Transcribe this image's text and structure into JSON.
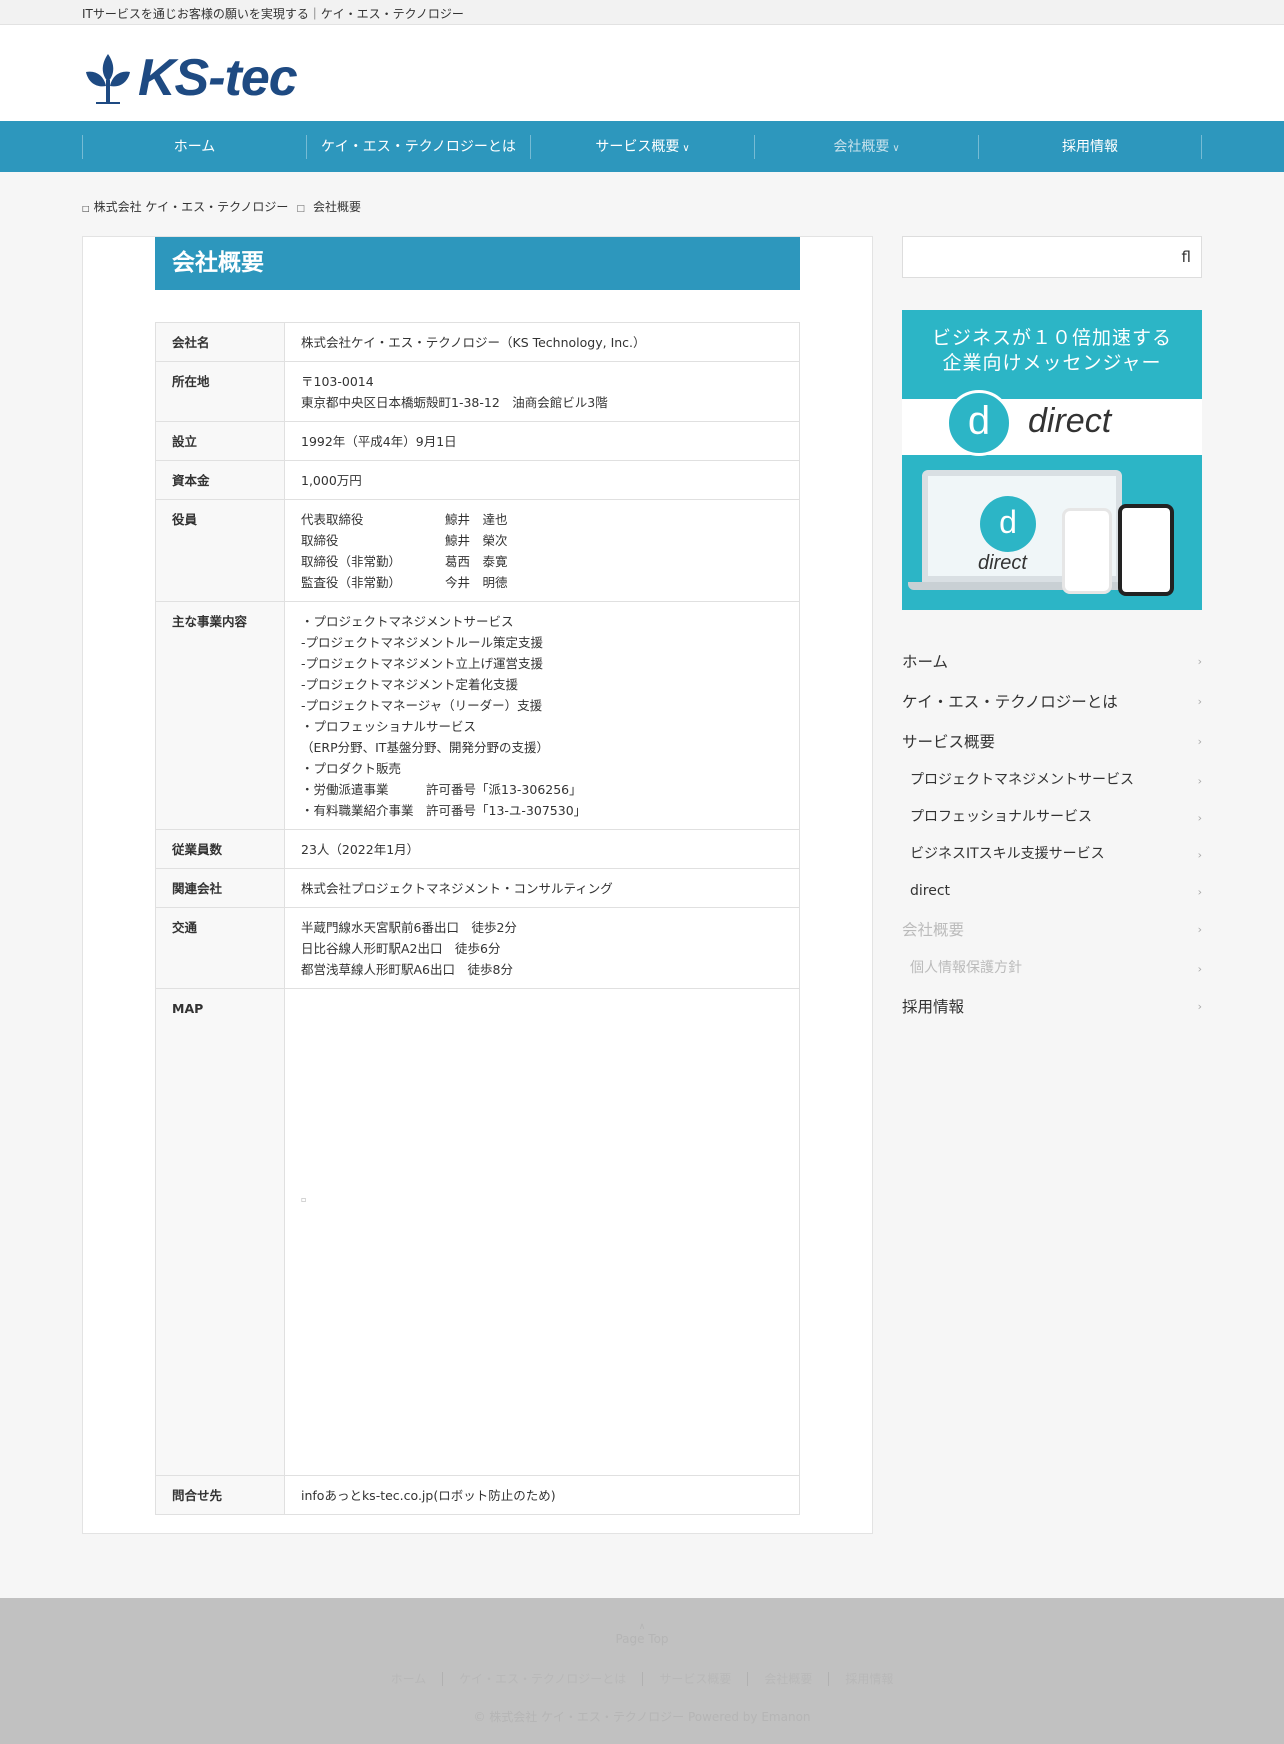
{
  "topbar": {
    "tagline": "ITサービスを通じお客様の願いを実現する｜ケイ・エス・テクノロジー"
  },
  "header": {
    "logo_text": "KS-tec"
  },
  "nav": {
    "items": [
      {
        "label": "ホーム",
        "has_dropdown": false,
        "active": false
      },
      {
        "label": "ケイ・エス・テクノロジーとは",
        "has_dropdown": false,
        "active": false
      },
      {
        "label": "サービス概要",
        "has_dropdown": true,
        "active": false
      },
      {
        "label": "会社概要",
        "has_dropdown": true,
        "active": true
      },
      {
        "label": "採用情報",
        "has_dropdown": false,
        "active": false
      }
    ]
  },
  "breadcrumb": {
    "home": "株式会社 ケイ・エス・テクノロジー",
    "current": "会社概要"
  },
  "page": {
    "title": "会社概要"
  },
  "company": {
    "name": {
      "label": "会社名",
      "value": "株式会社ケイ・エス・テクノロジー（KS Technology, Inc.）"
    },
    "address": {
      "label": "所在地",
      "postal": "〒103-0014",
      "street": "東京都中央区日本橋蛎殻町1-38-12　油商会館ビル3階"
    },
    "founded": {
      "label": "設立",
      "value": "1992年（平成4年）9月1日"
    },
    "capital": {
      "label": "資本金",
      "value": "1,000万円"
    },
    "officers": {
      "label": "役員",
      "list": [
        {
          "role": "代表取締役",
          "name": "鯨井　達也"
        },
        {
          "role": "取締役",
          "name": "鯨井　榮次"
        },
        {
          "role": "取締役（非常勤）",
          "name": "葛西　泰寛"
        },
        {
          "role": "監査役（非常勤）",
          "name": "今井　明徳"
        }
      ]
    },
    "business": {
      "label": "主な事業内容",
      "lines": [
        "・プロジェクトマネジメントサービス",
        "-プロジェクトマネジメントルール策定支援",
        "-プロジェクトマネジメント立上げ運営支援",
        "-プロジェクトマネジメント定着化支援",
        "-プロジェクトマネージャ（リーダー）支援",
        "・プロフェッショナルサービス",
        "（ERP分野、IT基盤分野、開発分野の支援）",
        "・プロダクト販売",
        "・労働派遣事業　　　許可番号「派13-306256」",
        "・有料職業紹介事業　許可番号「13-ユ-307530」"
      ]
    },
    "employees": {
      "label": "従業員数",
      "value": "23人（2022年1月）"
    },
    "affiliate": {
      "label": "関連会社",
      "value": "株式会社プロジェクトマネジメント・コンサルティング"
    },
    "access": {
      "label": "交通",
      "lines": [
        "半蔵門線水天宮駅前6番出口　徒歩2分",
        "日比谷線人形町駅A2出口　徒歩6分",
        "都営浅草線人形町駅A6出口　徒歩8分"
      ]
    },
    "map": {
      "label": "MAP"
    },
    "contact": {
      "label": "問合せ先",
      "value": "infoあっとks-tec.co.jp(ロボット防止のため)"
    }
  },
  "sidebar": {
    "search_icon": "search-icon",
    "banner": {
      "headline_line1": "ビジネスが１０倍加速する",
      "headline_line2": "企業向けメッセンジャー",
      "brand": "direct",
      "glyph": "d"
    },
    "menu": [
      {
        "label": "ホーム",
        "level": 1,
        "muted": false
      },
      {
        "label": "ケイ・エス・テクノロジーとは",
        "level": 1,
        "muted": false
      },
      {
        "label": "サービス概要",
        "level": 1,
        "muted": false
      },
      {
        "label": "プロジェクトマネジメントサービス",
        "level": 2,
        "muted": false
      },
      {
        "label": "プロフェッショナルサービス",
        "level": 2,
        "muted": false
      },
      {
        "label": "ビジネスITスキル支援サービス",
        "level": 2,
        "muted": false
      },
      {
        "label": "direct",
        "level": 2,
        "muted": false
      },
      {
        "label": "会社概要",
        "level": 1,
        "muted": true
      },
      {
        "label": "個人情報保護方針",
        "level": 2,
        "muted": true
      },
      {
        "label": "採用情報",
        "level": 1,
        "muted": false
      }
    ]
  },
  "footer": {
    "pagetop": "Page Top",
    "nav": [
      "ホーム",
      "ケイ・エス・テクノロジーとは",
      "サービス概要",
      "会社概要",
      "採用情報"
    ],
    "copyright": "© 株式会社 ケイ・エス・テクノロジー Powered by Emanon"
  },
  "colors": {
    "accent": "#2d97bd",
    "brand_logo": "#1e4a82",
    "footer_bg": "#c1c1c1"
  }
}
